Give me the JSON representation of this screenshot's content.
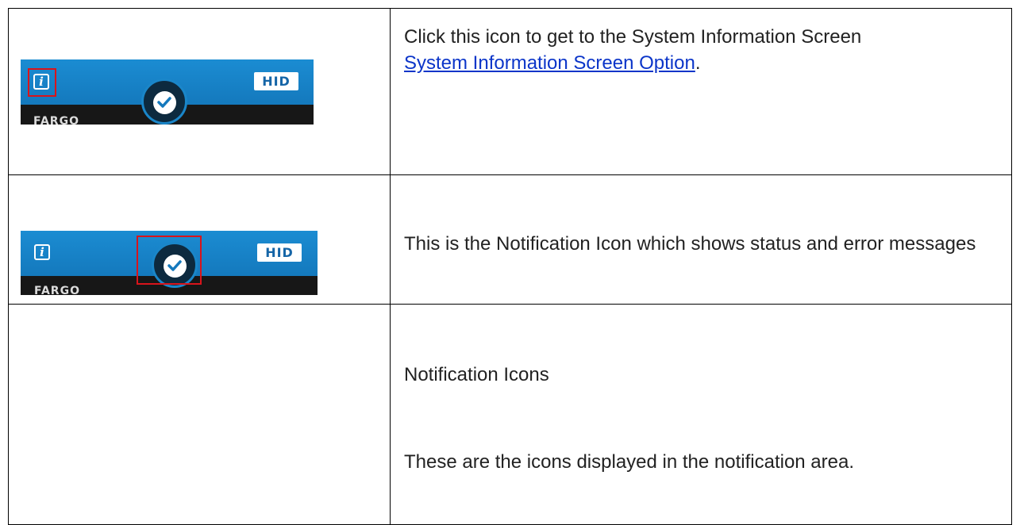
{
  "rows": [
    {
      "image": {
        "info_glyph": "i",
        "brand_logo": "HID",
        "brand_text": "FARGO",
        "highlight": "info-icon"
      },
      "text": "Click this icon to get to the System Information Screen",
      "link": "System Information Screen Option",
      "trailing": "."
    },
    {
      "image": {
        "info_glyph": "i",
        "brand_logo": "HID",
        "brand_text": "FARGO",
        "highlight": "notification-icon"
      },
      "text": "This is the Notification Icon which shows status and error messages"
    },
    {
      "heading": "Notification Icons",
      "text": "These are the icons displayed in the notification area."
    }
  ],
  "colors": {
    "header_bar": "#1b8cd2",
    "highlight": "#d9141b",
    "link": "#0b35c9"
  },
  "icons": [
    "info-icon",
    "check-circle-icon",
    "hid-logo"
  ]
}
